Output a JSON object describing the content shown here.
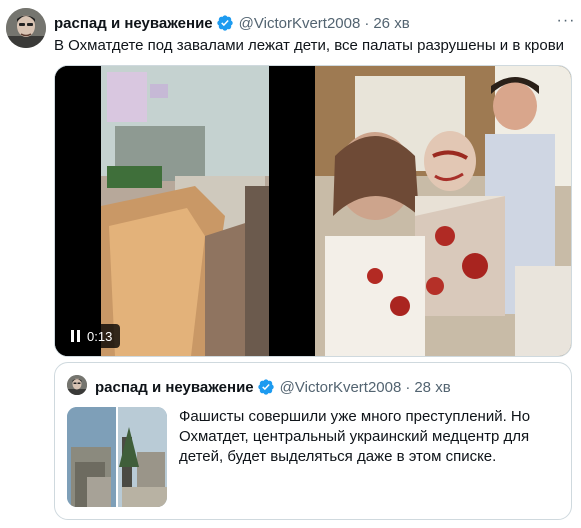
{
  "tweet": {
    "author_name": "распад и неуважение",
    "handle": "@VictorKvert2008",
    "separator": "·",
    "time": "26 хв",
    "more_label": "···",
    "text": "В Охматдете под завалами лежат дети, все палаты разрушены и в крови",
    "video_duration": "0:13"
  },
  "quoted": {
    "author_name": "распад и неуважение",
    "handle": "@VictorKvert2008",
    "separator": "·",
    "time": "28 хв",
    "text": "Фашисты совершили уже много преступлений. Но Охматдет, центральный украинский медцентр для детей, будет выделяться даже в этом списке."
  },
  "icons": {
    "verified": "verified-badge-icon",
    "more": "more-options-icon",
    "video": "pause-icon"
  },
  "colors": {
    "verified_blue": "#1d9bf0",
    "secondary_text": "#536471",
    "border": "#cfd9de"
  }
}
